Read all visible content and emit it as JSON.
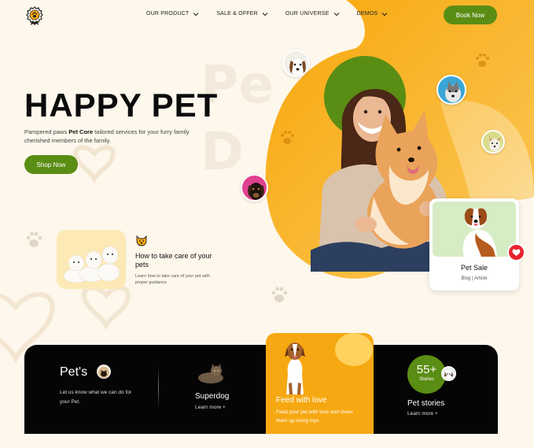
{
  "header": {
    "logo": "paw-badge-logo",
    "nav": [
      "OUR PRODUCT",
      "SALE & OFFER",
      "OUR UNIVERSE",
      "DEMOS"
    ],
    "book_label": "Book Now"
  },
  "hero": {
    "title": "HAPPY PET",
    "desc_pre": "Pampered paws ",
    "desc_brand": "Pet Core",
    "desc_post": " tailored services for your furry family cherished members of the family.",
    "shop_label": "Shop Now"
  },
  "care": {
    "title": "How  to take care of your pets",
    "subtitle": "Learn how to take care of your pet with proper guidance"
  },
  "sale_card": {
    "title": "Pet Sale",
    "subtitle": "Blog | Article"
  },
  "bottom": {
    "pets_title": "Pet's",
    "pets_desc": "Let us know what we can do for your Pet.",
    "superdog_title": "Superdog",
    "superdog_link": "Learn more +",
    "feed_title": "Feed with love",
    "feed_desc": "Feed your pet with love and cheer them up using toys.",
    "stories_count": "55+",
    "stories_label": "Stories",
    "stories_title": "Pet stories",
    "stories_link": "Learn more +"
  },
  "colors": {
    "accent_green": "#5a8d14",
    "accent_orange": "#f6a812",
    "background": "#fdf7ec",
    "band": "#050505",
    "heart_red": "#e8232e"
  },
  "icons": [
    "paw-badge-logo",
    "chevron-down-icon",
    "paw-icon",
    "heart-icon"
  ]
}
